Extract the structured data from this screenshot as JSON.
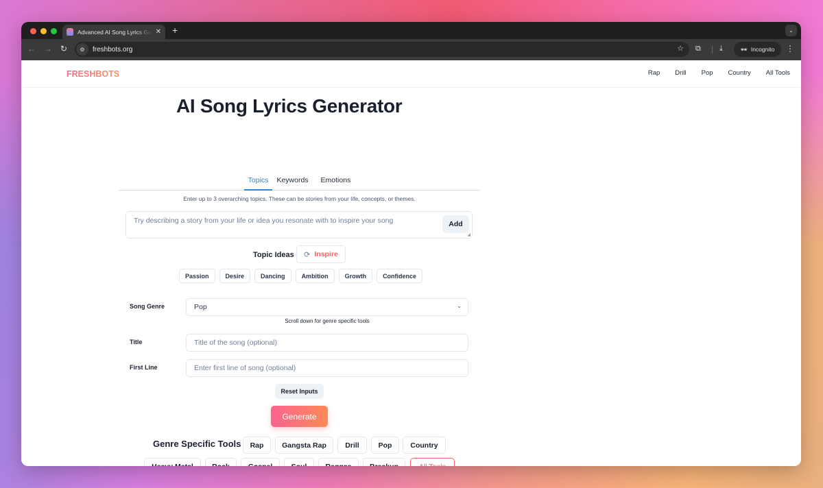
{
  "browser": {
    "tab_title": "Advanced AI Song Lyrics Generator",
    "tab_close": "✕",
    "new_tab": "+",
    "tab_search": "⌄",
    "url": "freshbots.org",
    "back": "←",
    "forward": "→",
    "reload": "↻",
    "site_info": "⚙",
    "bookmark": "☆",
    "extensions": "⧉",
    "download": "⤓",
    "profile_label": "Incognito",
    "profile_icon": "🕶",
    "menu": "⋮"
  },
  "site": {
    "logo": "FRESHBOTS",
    "brand_gradient": [
      "#f36a8e",
      "#f7925e"
    ],
    "nav": [
      "Rap",
      "Drill",
      "Pop",
      "Country",
      "All Tools"
    ]
  },
  "main": {
    "title": "AI Song Lyrics Generator",
    "tabs": [
      {
        "label": "Topics",
        "active": true
      },
      {
        "label": "Keywords",
        "active": false
      },
      {
        "label": "Emotions",
        "active": false
      }
    ],
    "helper_text": "Enter up to 3 overarching topics. These can be stories from your life, concepts, or themes.",
    "topic_input": {
      "value": "",
      "placeholder": "Try describing a story from your life or idea you resonate with to inspire your song",
      "add_label": "Add"
    },
    "topic_ideas_label": "Topic Ideas",
    "inspire_label": "Inspire",
    "inspire_icon": "⟳",
    "topic_chips": [
      "Passion",
      "Desire",
      "Dancing",
      "Ambition",
      "Growth",
      "Confidence"
    ],
    "form": {
      "genre_label": "Song Genre",
      "genre_value": "Pop",
      "genre_chevron": "⌄",
      "genre_note": "Scroll down for genre specific tools",
      "title_label": "Title",
      "title_value": "",
      "title_placeholder": "Title of the song (optional)",
      "first_line_label": "First Line",
      "first_line_value": "",
      "first_line_placeholder": "Enter first line of song (optional)"
    },
    "reset_label": "Reset Inputs",
    "generate_label": "Generate",
    "accent_color": "#3182ce",
    "genre_tools": {
      "label": "Genre Specific Tools",
      "row1": [
        "Rap",
        "Gangsta Rap",
        "Drill",
        "Pop",
        "Country"
      ],
      "row2": [
        "Heavy Metal",
        "Rock",
        "Gospel",
        "Soul",
        "Reggae",
        "Breakup",
        "All Tools"
      ]
    }
  }
}
